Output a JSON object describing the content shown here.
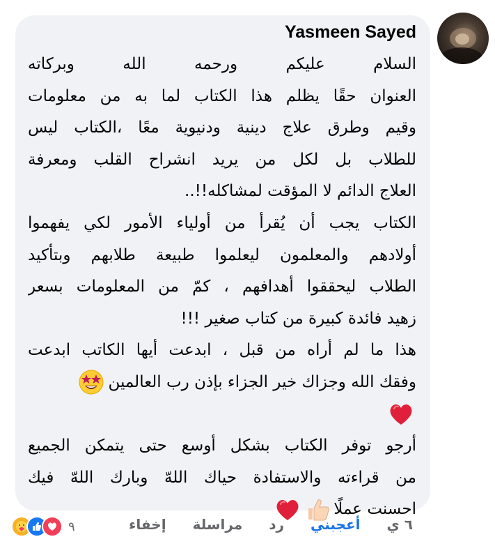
{
  "comment": {
    "author": "Yasmeen Sayed",
    "paragraphs": [
      [
        "السلام عليكم ورحمه الله وبركاته",
        "العنوان حقًا يظلم هذا الكتاب لما به من معلومات",
        "وقيم وطرق علاج دينية ودنيوية معًا ،الكتاب ليس",
        "للطلاب بل لكل من يريد انشراح القلب ومعرفة",
        "العلاج الدائم لا المؤقت لمشاكله!!.."
      ],
      [
        "الكتاب يجب أن يُقرأ من أولياء الأمور لكي يفهموا",
        "أولادهم والمعلمون ليعلموا طبيعة طلابهم وبتأكيد",
        "الطلاب ليحققوا أهدافهم ، كمّ من المعلومات بسعر",
        "زهيد فائدة كبيرة من كتاب صغير !!!"
      ],
      [
        "هذا ما لم أراه من قبل ، ابدعت أيها الكاتب ابدعت",
        "وفقك الله وجزاك خير الجزاء بإذن رب العالمين"
      ],
      [
        "أرجو توفر الكتاب بشكل أوسع حتى يتمكن الجميع",
        "من قراءته والاستفادة حياك اللهّ وبارك اللهّ فيك",
        "احسنت عملًا"
      ]
    ],
    "emojis": {
      "star_struck": "star-struck-emoji",
      "heart": "red-heart-emoji",
      "thumbs_up": "thumbs-up-emoji"
    }
  },
  "actions": {
    "time": "٦ ي",
    "like": "أعجبني",
    "reply": "رد",
    "message": "مراسلة",
    "hide": "إخفاء"
  },
  "reactions": {
    "count": "٩",
    "icons": [
      "care-reaction-icon",
      "like-reaction-icon",
      "love-reaction-icon"
    ]
  },
  "colors": {
    "bubble": "#f0f2f5",
    "text": "#050505",
    "meta": "#65676b",
    "like_active": "#1b74e4",
    "love": "#f33e58",
    "like": "#1877f2",
    "care": "#f7b125"
  }
}
